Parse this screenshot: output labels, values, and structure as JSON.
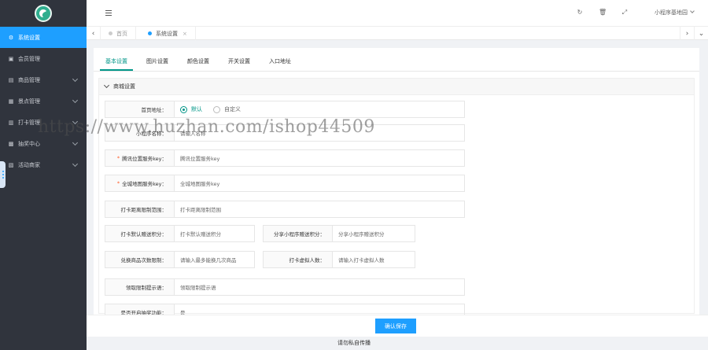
{
  "sidebar": {
    "items": [
      {
        "label": "系统设置",
        "icon": "gears-icon"
      },
      {
        "label": "会员管理",
        "icon": "user-icon"
      },
      {
        "label": "商品管理",
        "icon": "cart-icon"
      },
      {
        "label": "景点管理",
        "icon": "grid-icon"
      },
      {
        "label": "打卡管理",
        "icon": "bank-icon"
      },
      {
        "label": "抽奖中心",
        "icon": "gift-icon"
      },
      {
        "label": "活动商家",
        "icon": "store-icon"
      }
    ]
  },
  "header": {
    "user_name": "小程序基地园"
  },
  "tabbar": {
    "tabs": [
      {
        "label": "首页"
      },
      {
        "label": "系统设置",
        "close": "×"
      }
    ]
  },
  "sub_tabs": [
    "基本设置",
    "图片设置",
    "颜色设置",
    "开关设置",
    "入口地址"
  ],
  "section": {
    "title": "商城设置",
    "fields": {
      "home_address": {
        "label": "首页地址：",
        "options": [
          "默认",
          "自定义"
        ]
      },
      "wechat_name": {
        "label": "小程序名称：",
        "value": "请输入名称"
      },
      "map_key": {
        "label": "腾讯位置服务key：",
        "value": "腾讯位置服务key"
      },
      "mch_key": {
        "label": "全城地图服务key：",
        "value": "全城地图服务key"
      },
      "checkin_range": {
        "label": "打卡距离限制范围：",
        "value": "打卡距离限制范围"
      },
      "checkin_points": {
        "label": "打卡默认赠送积分：",
        "value": "打卡默认赠送积分"
      },
      "share_points": {
        "label": "分享小程序赠送积分：",
        "value": "分享小程序赠送积分"
      },
      "exchange_limit": {
        "label": "兑换商品次数限制：",
        "value": "请输入最多能换几次商品"
      },
      "virtual_count": {
        "label": "打卡虚拟人数：",
        "value": "请输入打卡虚拟人数"
      },
      "redeem_tip": {
        "label": "领取限制提示语：",
        "value": "领取限制提示语"
      },
      "extra": {
        "label": "是否开启抽奖功能：",
        "value": "是"
      }
    }
  },
  "footer": {
    "submit": "确认保存",
    "copyright": "请勿私自传播"
  },
  "watermark": "https://www.huzhan.com/ishop44509",
  "colors": {
    "sidebar_bg": "#30343d",
    "accent_blue": "#1e9fff",
    "accent_green": "#009688"
  }
}
